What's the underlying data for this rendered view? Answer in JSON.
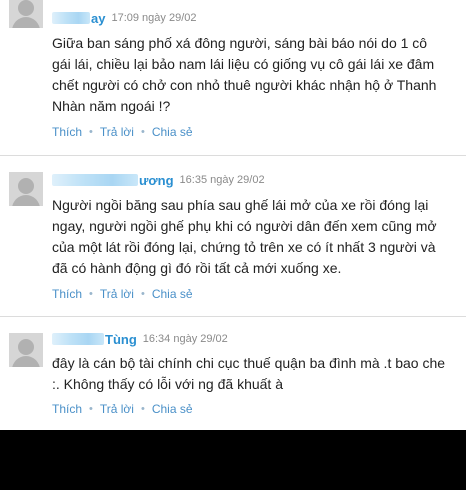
{
  "comments": [
    {
      "name_suffix": "ay",
      "time": "17:09 ngày 29/02",
      "lines": [
        "Giữa ban sáng phố xá đông người, sáng bài báo nói do 1 cô",
        "gái lái, chiều lại bảo nam lái liệu có giống vụ cô gái lái xe đâm",
        "chết người có chở con nhỏ thuê người khác nhận hộ ở Thanh",
        "Nhàn năm ngoái !?"
      ]
    },
    {
      "name_suffix": "ương",
      "time": "16:35 ngày 29/02",
      "lines": [
        "Người ngồi băng sau phía sau ghế lái mở của xe rồi đóng lại",
        "ngay, người ngồi ghế phụ khi có người dân đến xem cũng mở",
        "của một lát rồi đóng lại, chứng tỏ trên xe có ít nhất 3 người và",
        "đã có hành động gì đó rồi tất cả mới xuống xe."
      ]
    },
    {
      "name_suffix": "Tùng",
      "time": "16:34 ngày 29/02",
      "lines": [
        "đây là cán bộ tài chính chi cục thuế quận ba đình mà .t bao che",
        ":. Không thấy có lỗi với ng đã khuất à"
      ]
    }
  ],
  "actions": {
    "like": "Thích",
    "reply": "Trả lời",
    "share": "Chia sẻ",
    "separator": "•"
  },
  "colors": {
    "link": "#4a90c8",
    "name": "#2a8fd1",
    "time": "#8a8a8a",
    "text": "#222222"
  }
}
